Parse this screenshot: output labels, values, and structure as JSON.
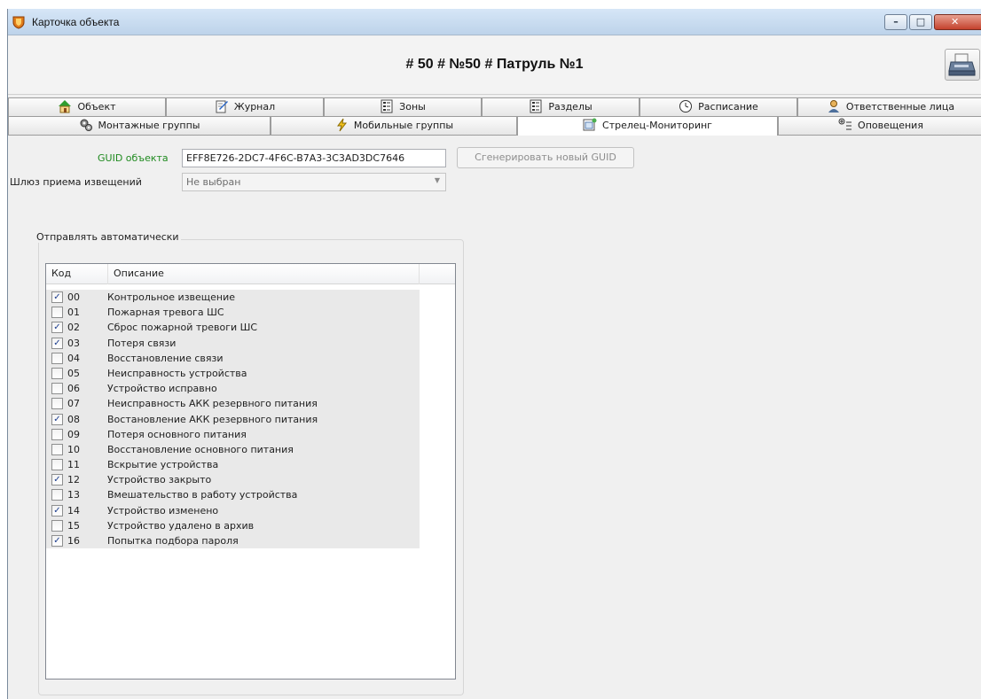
{
  "window": {
    "title": "Карточка объекта",
    "controls": {
      "minimize": "–",
      "maximize": "□",
      "close": "✕"
    }
  },
  "header": {
    "title": "# 50 # №50 # Патруль №1",
    "print_icon": "printer-icon"
  },
  "tabs_row1": [
    {
      "label": "Объект",
      "icon": "house-icon"
    },
    {
      "label": "Журнал",
      "icon": "journal-icon"
    },
    {
      "label": "Зоны",
      "icon": "zones-icon"
    },
    {
      "label": "Разделы",
      "icon": "sections-icon"
    },
    {
      "label": "Расписание",
      "icon": "clock-icon"
    },
    {
      "label": "Ответственные лица",
      "icon": "person-icon"
    }
  ],
  "tabs_row2": [
    {
      "label": "Монтажные группы",
      "icon": "gears-icon"
    },
    {
      "label": "Мобильные группы",
      "icon": "lightning-icon"
    },
    {
      "label": "Стрелец-Мониторинг",
      "icon": "monitoring-icon",
      "active": true
    },
    {
      "label": "Оповещения",
      "icon": "notify-icon"
    }
  ],
  "monitoring": {
    "guid_label": "GUID объекта",
    "guid_value": "EFF8E726-2DC7-4F6C-B7A3-3C3AD3DC7646",
    "generate_button": "Сгенерировать новый GUID",
    "gateway_label": "Шлюз приема извещений",
    "gateway_value": "Не выбран",
    "auto_send_title": "Отправлять автоматически",
    "columns": {
      "code": "Код",
      "description": "Описание"
    },
    "events": [
      {
        "code": "00",
        "description": "Контрольное извещение",
        "checked": true
      },
      {
        "code": "01",
        "description": "Пожарная тревога ШС",
        "checked": false
      },
      {
        "code": "02",
        "description": "Сброс пожарной тревоги ШС",
        "checked": true
      },
      {
        "code": "03",
        "description": "Потеря связи",
        "checked": true
      },
      {
        "code": "04",
        "description": "Восстановление связи",
        "checked": false
      },
      {
        "code": "05",
        "description": "Неисправность устройства",
        "checked": false
      },
      {
        "code": "06",
        "description": "Устройство исправно",
        "checked": false
      },
      {
        "code": "07",
        "description": "Неисправность АКК резервного питания",
        "checked": false
      },
      {
        "code": "08",
        "description": "Востановление АКК резервного питания",
        "checked": true
      },
      {
        "code": "09",
        "description": "Потеря основного питания",
        "checked": false
      },
      {
        "code": "10",
        "description": "Восстановление основного питания",
        "checked": false
      },
      {
        "code": "11",
        "description": "Вскрытие устройства",
        "checked": false
      },
      {
        "code": "12",
        "description": "Устройство закрыто",
        "checked": true
      },
      {
        "code": "13",
        "description": "Вмешательство в работу устройства",
        "checked": false
      },
      {
        "code": "14",
        "description": "Устройство изменено",
        "checked": true
      },
      {
        "code": "15",
        "description": "Устройство удалено в архив",
        "checked": false
      },
      {
        "code": "16",
        "description": "Попытка подбора пароля",
        "checked": true
      }
    ]
  }
}
